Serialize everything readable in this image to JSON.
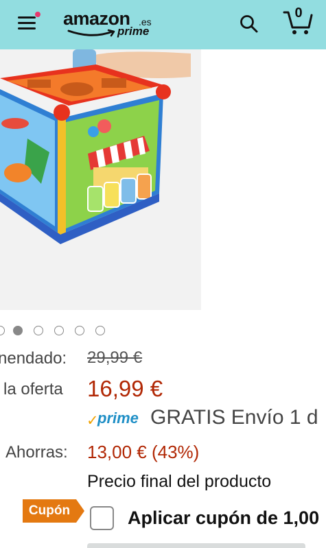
{
  "header": {
    "logo_text": "amazon",
    "logo_tld": ".es",
    "logo_prime": "prime",
    "cart_count": "0",
    "colors": {
      "header_bg": "#92dde0",
      "notification_dot": "#e8386d"
    },
    "icons": [
      "menu-icon",
      "search-icon",
      "cart-icon"
    ]
  },
  "gallery": {
    "image_count": 6,
    "active_index": 0
  },
  "pricing": {
    "recommended_label": "nendado:",
    "recommended_price": "29,99 €",
    "deal_label": "la oferta",
    "deal_price": "16,99 €",
    "prime_label": "prime",
    "shipping_text": "GRATIS Envío 1 d",
    "savings_label": "Ahorras:",
    "savings_value": "13,00 € (43%)",
    "final_note": "Precio final del producto",
    "colors": {
      "price": "#b12704",
      "prime_blue": "#1f8fc6",
      "prime_check": "#f0a200"
    }
  },
  "coupon": {
    "badge": "Cupón",
    "checkbox_label": "Aplicar cupón de 1,00",
    "checked": false,
    "colors": {
      "badge": "#e47911"
    }
  }
}
